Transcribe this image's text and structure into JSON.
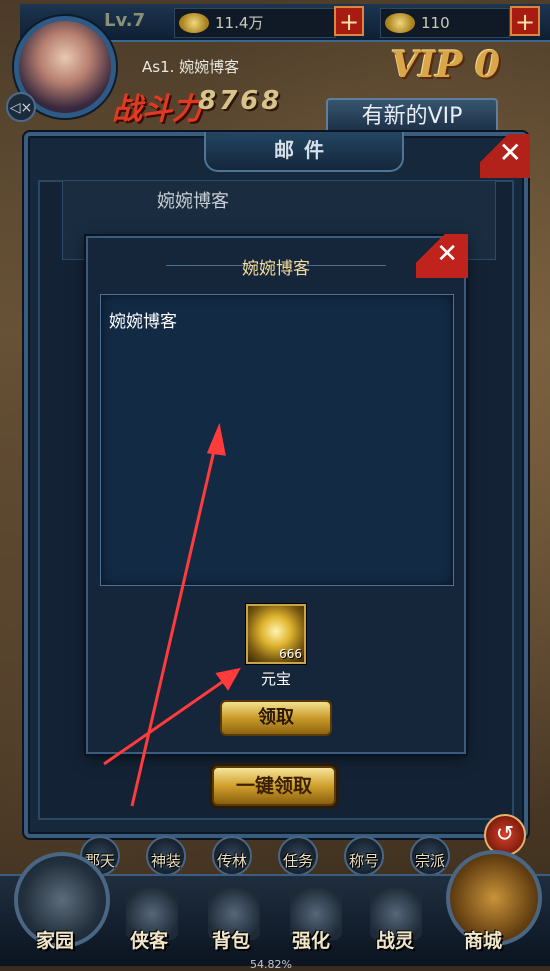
{
  "hud": {
    "level": "Lv.7",
    "silver": "11.4万",
    "gold": "110",
    "player_name": "As1. 婉婉博客",
    "vip": "VIP 0",
    "power_label": "战斗力",
    "power_value": "8768",
    "vip_banner": "有新的VIP"
  },
  "mail": {
    "title": "邮件",
    "behind_row_text": "婉婉博客",
    "letter": {
      "title": "婉婉博客",
      "body": "婉婉博客",
      "reward": {
        "name": "元宝",
        "count": "666",
        "icon": "gold-ingot-icon"
      },
      "claim_label": "领取"
    },
    "claim_all_label": "一键领取"
  },
  "small_nav": [
    "郡天",
    "神装",
    "传林",
    "任务",
    "称号",
    "宗派"
  ],
  "back_label": "返回",
  "bottom_nav": {
    "home": "家园",
    "hero": "侠客",
    "bag": "背包",
    "strengthen": "强化",
    "spirit": "战灵",
    "shop": "商城"
  },
  "progress_text": "54.82%",
  "colors": {
    "arrow": "#ff3b3b",
    "gold_button": "#c99b2a",
    "close_red": "#c0231b",
    "panel_border": "#3b5c7c"
  }
}
